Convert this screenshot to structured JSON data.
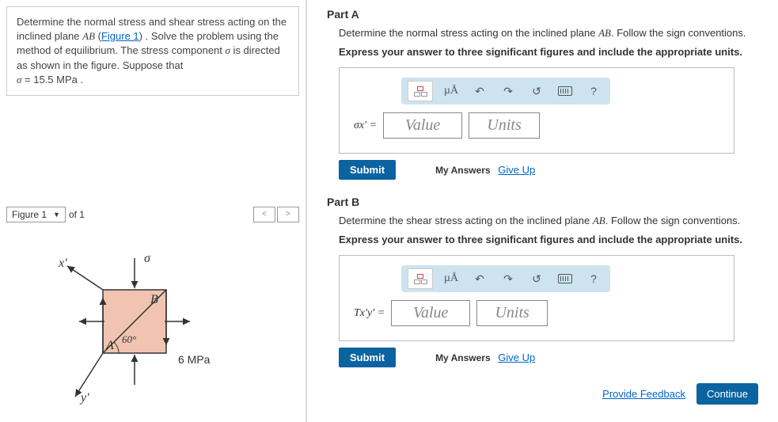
{
  "problem": {
    "text1": "Determine the normal stress and shear stress acting on the inclined plane ",
    "ab": "AB",
    "fig_link_pre": " (",
    "fig_link": "Figure 1",
    "fig_link_post": ") . Solve the problem using the method of equilibrium. The stress component ",
    "sigma": "σ",
    "text2": " is directed as shown in the figure. Suppose that",
    "text3_pre": "σ",
    "text3_post": " = 15.5 ",
    "mpa": "MPa",
    "dot": " ."
  },
  "figure": {
    "selected": "Figure 1",
    "of_text": "of 1",
    "labels": {
      "xprime": "x'",
      "yprime": "y'",
      "sigma": "σ",
      "A": "A",
      "B": "B",
      "angle": "60°",
      "bottom_stress": "6 MPa"
    }
  },
  "partA": {
    "title": "Part A",
    "desc_pre": "Determine the normal stress acting on the inclined plane ",
    "desc_ab": "AB",
    "desc_post": ". Follow the sign conventions.",
    "instr": "Express your answer to three significant figures and include the appropriate units.",
    "var": "σx'  =",
    "toolbar": {
      "mu": "µÅ"
    },
    "value_ph": "Value",
    "units_ph": "Units",
    "submit": "Submit",
    "my_answers": "My Answers",
    "give_up": "Give Up"
  },
  "partB": {
    "title": "Part B",
    "desc_pre": "Determine the shear stress acting on the inclined plane ",
    "desc_ab": "AB",
    "desc_post": ". Follow the sign conventions.",
    "instr": "Express your answer to three significant figures and include the appropriate units.",
    "var": "Tx'y'  =",
    "value_ph": "Value",
    "units_ph": "Units",
    "submit": "Submit",
    "my_answers": "My Answers",
    "give_up": "Give Up"
  },
  "footer": {
    "feedback": "Provide Feedback",
    "continue": "Continue"
  },
  "icons": {
    "help": "?"
  }
}
